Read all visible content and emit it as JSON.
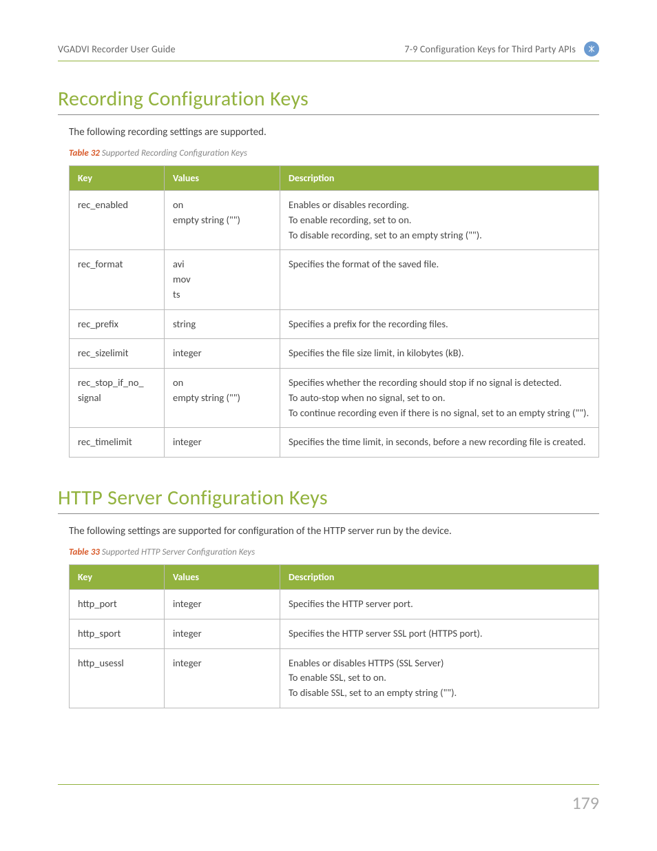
{
  "header": {
    "left": "VGADVI Recorder User Guide",
    "right": "7-9 Configuration Keys for Third Party APIs"
  },
  "section1": {
    "title": "Recording Configuration Keys",
    "intro": "The following recording settings are supported.",
    "caption_label": "Table 32",
    "caption_desc": "Supported Recording Configuration Keys",
    "columns": {
      "key": "Key",
      "values": "Values",
      "desc": "Description"
    },
    "rows": [
      {
        "key": "rec_enabled",
        "values": [
          "on",
          "empty string (\"\")"
        ],
        "desc": [
          "Enables or disables recording.",
          "To enable recording, set to on.",
          "To disable recording, set to an empty string (\"\")."
        ]
      },
      {
        "key": "rec_format",
        "values": [
          "avi",
          "mov",
          "ts"
        ],
        "desc": [
          "Specifies the format of the saved file."
        ]
      },
      {
        "key": "rec_prefix",
        "values": [
          "string"
        ],
        "desc": [
          "Specifies a prefix for the recording files."
        ]
      },
      {
        "key": "rec_sizelimit",
        "values": [
          "integer"
        ],
        "desc": [
          "Specifies the file size limit, in kilobytes (kB)."
        ]
      },
      {
        "key": "rec_stop_if_no_signal",
        "values": [
          "on",
          "empty string (\"\")"
        ],
        "desc": [
          "Specifies whether the recording should stop if no signal is detected.",
          "To auto-stop when no signal, set to on.",
          "To continue recording even if there is no signal, set to an empty string (\"\")."
        ]
      },
      {
        "key": "rec_timelimit",
        "values": [
          "integer"
        ],
        "desc": [
          "Specifies the time limit, in seconds, before a new recording file is created."
        ]
      }
    ]
  },
  "section2": {
    "title": "HTTP Server Configuration Keys",
    "intro": "The following settings are supported for configuration of the HTTP server run by the device.",
    "caption_label": "Table 33",
    "caption_desc": "Supported HTTP Server Configuration Keys",
    "columns": {
      "key": "Key",
      "values": "Values",
      "desc": "Description"
    },
    "rows": [
      {
        "key": "http_port",
        "values": [
          "integer"
        ],
        "desc": [
          "Specifies the HTTP server port."
        ]
      },
      {
        "key": "http_sport",
        "values": [
          "integer"
        ],
        "desc": [
          "Specifies the HTTP server SSL port (HTTPS port)."
        ]
      },
      {
        "key": "http_usessl",
        "values": [
          "integer"
        ],
        "desc": [
          "Enables or disables HTTPS (SSL Server)",
          "To enable SSL, set to on.",
          "To disable SSL, set to an empty string (\"\")."
        ]
      }
    ]
  },
  "page_number": "179"
}
